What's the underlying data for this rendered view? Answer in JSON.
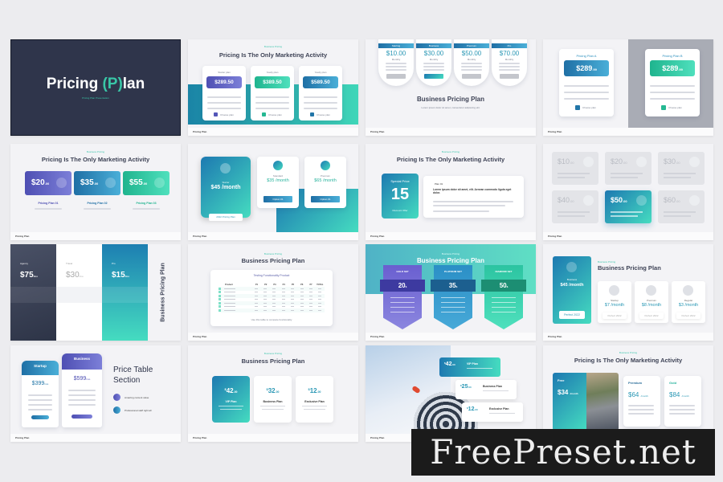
{
  "slides": {
    "s1": {
      "title_a": "Pricing ",
      "title_p": "(P)",
      "title_b": "lan",
      "subtitle": "Pricing Plan Presentation"
    },
    "s2": {
      "kicker": "Business Pricing",
      "title": "Pricing Is The Only Marketing Activity",
      "plans": [
        {
          "name": "Starter plan",
          "price": "$289.50"
        },
        {
          "name": "Yearly plan",
          "price": "$389.50"
        },
        {
          "name": "Yearly plan",
          "price": "$589.50"
        }
      ],
      "rows": [
        "Content one",
        "Content two",
        "Content three"
      ],
      "cta": "Choose plan"
    },
    "s3": {
      "title": "Business Pricing Plan",
      "plans": [
        {
          "name": "Starting",
          "price": "$10.00",
          "period": "Monthly"
        },
        {
          "name": "Business",
          "price": "$30.00",
          "period": "Monthly"
        },
        {
          "name": "Premium",
          "price": "$50.00",
          "period": "Monthly"
        },
        {
          "name": "Pro",
          "price": "$70.00",
          "period": "Monthly"
        }
      ],
      "body": "Lorem ipsum dolor sit amet, consectetur adipiscing elit."
    },
    "s4": {
      "plans": [
        {
          "name": "Pricing Plan A",
          "price": "$289",
          "cents": ".99"
        },
        {
          "name": "Pricing Plan B",
          "price": "$289",
          "cents": ".99"
        }
      ],
      "cta": "Choose plan"
    },
    "s5": {
      "kicker": "Business Pricing",
      "title": "Pricing Is The Only Marketing Activity",
      "plans": [
        {
          "price": "$20",
          "cents": ".00",
          "name": "Pricing Plan 01"
        },
        {
          "price": "$35",
          "cents": ".00",
          "name": "Pricing Plan 02"
        },
        {
          "price": "$55",
          "cents": ".00",
          "name": "Pricing Plan 03"
        }
      ]
    },
    "s6": {
      "plans": [
        {
          "name": "Starter",
          "price": "$45 /month",
          "badge": "2022 Pricing Plan"
        },
        {
          "name": "Standard",
          "price": "$35 /month",
          "btn": "Option 01"
        },
        {
          "name": "Premium",
          "price": "$65 /month",
          "btn": "Option 01"
        }
      ]
    },
    "s7": {
      "kicker": "Business Pricing",
      "title": "Pricing Is The Only Marketing Activity",
      "special": "Special Price",
      "num": "15",
      "sup": "$",
      "disc": "Discount Offer",
      "tag": "Plan 01",
      "head": "Lorem ipsum dolor sit amet, elit. Aenean commodo ligula eget dolor."
    },
    "s8": {
      "tiles": [
        {
          "price": "$10",
          "cents": ".00"
        },
        {
          "price": "$20",
          "cents": ".00"
        },
        {
          "price": "$30",
          "cents": ".00"
        },
        {
          "price": "$40",
          "cents": ".00"
        },
        {
          "price": "$50",
          "cents": ".00",
          "active": true
        },
        {
          "price": "$60",
          "cents": ".00"
        }
      ]
    },
    "s9": {
      "cols": [
        {
          "name": "Agency",
          "price": "$75",
          "per": "/mo"
        },
        {
          "name": "Travel",
          "price": "$30",
          "per": "/mo"
        },
        {
          "name": "Pro",
          "price": "$15",
          "per": "/mo"
        }
      ],
      "side": "Business Pricing Plan"
    },
    "s10": {
      "kicker": "Business Pricing",
      "title": "Business Pricing Plan",
      "table_title": "Testing Functionality Product",
      "headers": [
        "Product",
        "P1",
        "P2",
        "P3",
        "P4",
        "P5",
        "P6",
        "P7",
        "TOTAL"
      ],
      "rows": 7,
      "note": "Use this table to compare functionality"
    },
    "s11": {
      "kicker": "Business Pricing",
      "title": "Business Pricing Plan",
      "plans": [
        {
          "name": "GOLD SET",
          "price": "20",
          "unit": "$"
        },
        {
          "name": "PLATINUM SET",
          "price": "35",
          "unit": "$"
        },
        {
          "name": "DIAMOND SET",
          "price": "50",
          "unit": "$"
        }
      ]
    },
    "s12": {
      "kicker": "Business Pricing",
      "title": "Business Pricing Plan",
      "main": {
        "name": "Business",
        "price": "$45 /month",
        "btn": "Perfect 2022"
      },
      "plans": [
        {
          "name": "Startup",
          "price": "$7 /month"
        },
        {
          "name": "Premium",
          "price": "$8 /month"
        },
        {
          "name": "Regular",
          "price": "$3 /month"
        }
      ],
      "btn": "Perfect 2022"
    },
    "s13": {
      "plans": [
        {
          "name": "Startup",
          "price": "399",
          "per": "/mo"
        },
        {
          "name": "Business",
          "price": "599",
          "per": "/mo"
        }
      ],
      "title_a": "Price Table",
      "title_b": "Section",
      "feat1": "Amazing content value",
      "feat2": "Professional staff right all"
    },
    "s14": {
      "kicker": "Business Pricing",
      "title": "Business Pricing Plan",
      "plans": [
        {
          "price": "42",
          "cents": ".00",
          "name": "VIP Plan"
        },
        {
          "price": "32",
          "cents": ".00",
          "name": "Business Plan"
        },
        {
          "price": "12",
          "cents": ".00",
          "name": "Exclusive Plan"
        }
      ]
    },
    "s15": {
      "plans": [
        {
          "price": "42",
          "cents": ".00",
          "name": "VIP Plan"
        },
        {
          "price": "25",
          "cents": ".00",
          "name": "Business Plan"
        },
        {
          "price": "12",
          "cents": ".00",
          "name": "Exclusive Plan"
        }
      ]
    },
    "s16": {
      "kicker": "Business Pricing",
      "title": "Pricing Is The Only Marketing Activity",
      "plans": [
        {
          "name": "Free",
          "price": "$34",
          "per": "/month"
        },
        {
          "name": "Premium",
          "price": "$64",
          "per": "/month"
        },
        {
          "name": "Gold",
          "price": "$84",
          "per": "/month"
        }
      ]
    }
  },
  "footer_label": "Pricing Plan",
  "watermark": "FreePreset.net"
}
